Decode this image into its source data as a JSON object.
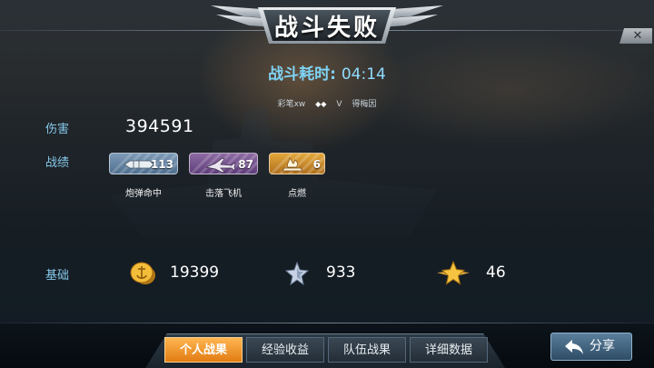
{
  "header": {
    "title": "战斗失败",
    "close_label": "✕"
  },
  "battle": {
    "duration_label": "战斗耗时:",
    "duration_value": "04:14",
    "player_left": "彩笔xw",
    "vs": "V",
    "player_right": "得梅因"
  },
  "damage": {
    "label": "伤害",
    "value": "394591"
  },
  "record": {
    "label": "战绩",
    "medals": [
      {
        "caption": "炮弹命中",
        "count": "113",
        "icon": "shell-icon"
      },
      {
        "caption": "击落飞机",
        "count": "87",
        "icon": "plane-icon"
      },
      {
        "caption": "点燃",
        "count": "6",
        "icon": "fire-icon"
      }
    ]
  },
  "base": {
    "label": "基础",
    "gold": "19399",
    "silver_star": "933",
    "gold_star": "46"
  },
  "tabs": [
    {
      "label": "个人战果",
      "active": true
    },
    {
      "label": "经验收益",
      "active": false
    },
    {
      "label": "队伍战果",
      "active": false
    },
    {
      "label": "详细数据",
      "active": false
    }
  ],
  "share": {
    "label": "分享"
  },
  "colors": {
    "accent_blue": "#86c8ea",
    "tab_active": "#f0921f",
    "medal_shell": "#6585a5",
    "medal_plane": "#7a5591",
    "medal_fire": "#d18f2c"
  }
}
